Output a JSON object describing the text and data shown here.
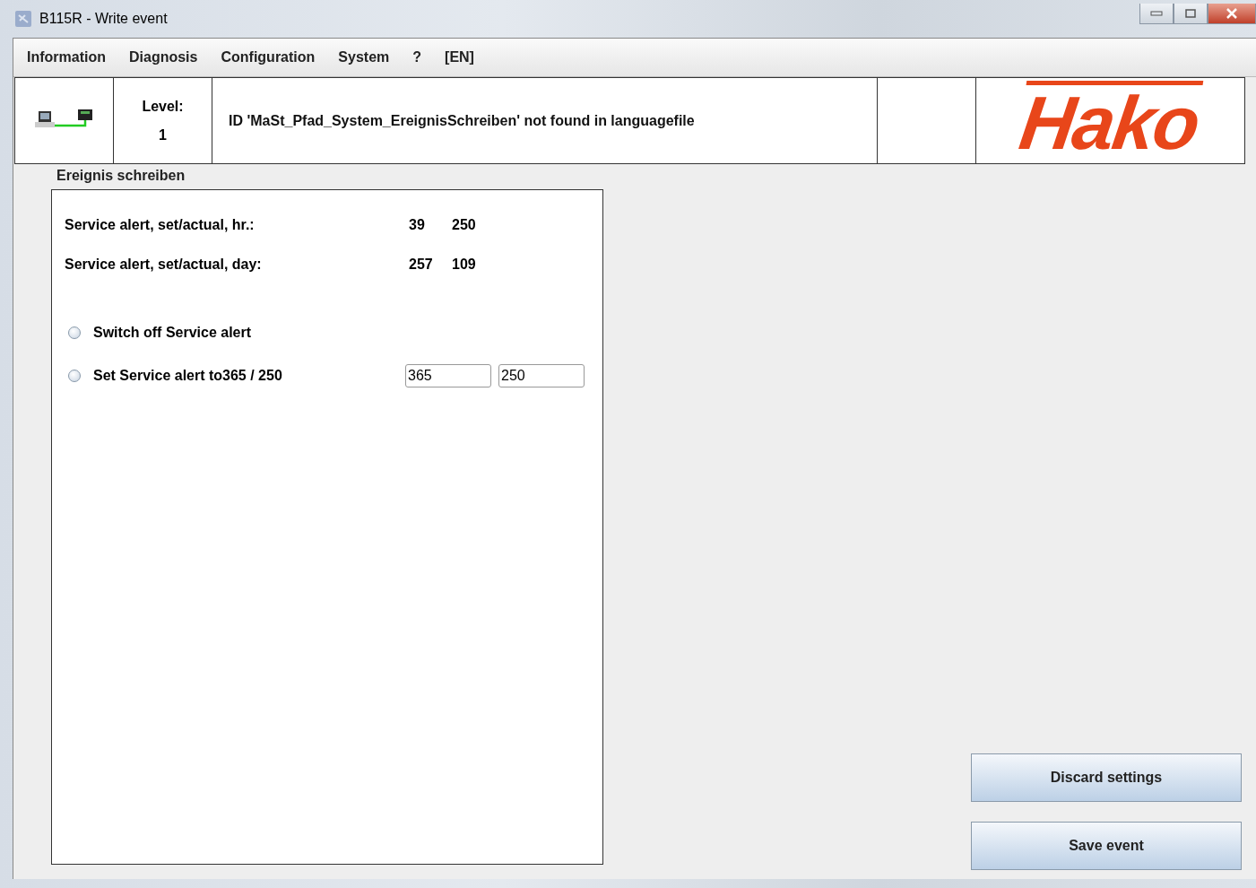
{
  "window": {
    "title": "B115R - Write event"
  },
  "menu": [
    "Information",
    "Diagnosis",
    "Configuration",
    "System",
    "?",
    "[EN]"
  ],
  "header": {
    "level_label": "Level:",
    "level_value": "1",
    "message": "ID 'MaSt_Pfad_System_EreignisSchreiben' not found in languagefile",
    "logo": "Hako"
  },
  "panel": {
    "title": "Ereignis schreiben",
    "readings": [
      {
        "label": "Service alert, set/actual, hr.:",
        "set": "39",
        "actual": "250"
      },
      {
        "label": "Service alert, set/actual, day:",
        "set": "257",
        "actual": "109"
      }
    ],
    "options": [
      {
        "label": "Switch off Service alert",
        "selected": false
      },
      {
        "label": "Set Service alert to365 / 250",
        "selected": false,
        "fields": [
          "365",
          "250"
        ]
      }
    ]
  },
  "buttons": [
    "Discard settings",
    "Save event"
  ]
}
